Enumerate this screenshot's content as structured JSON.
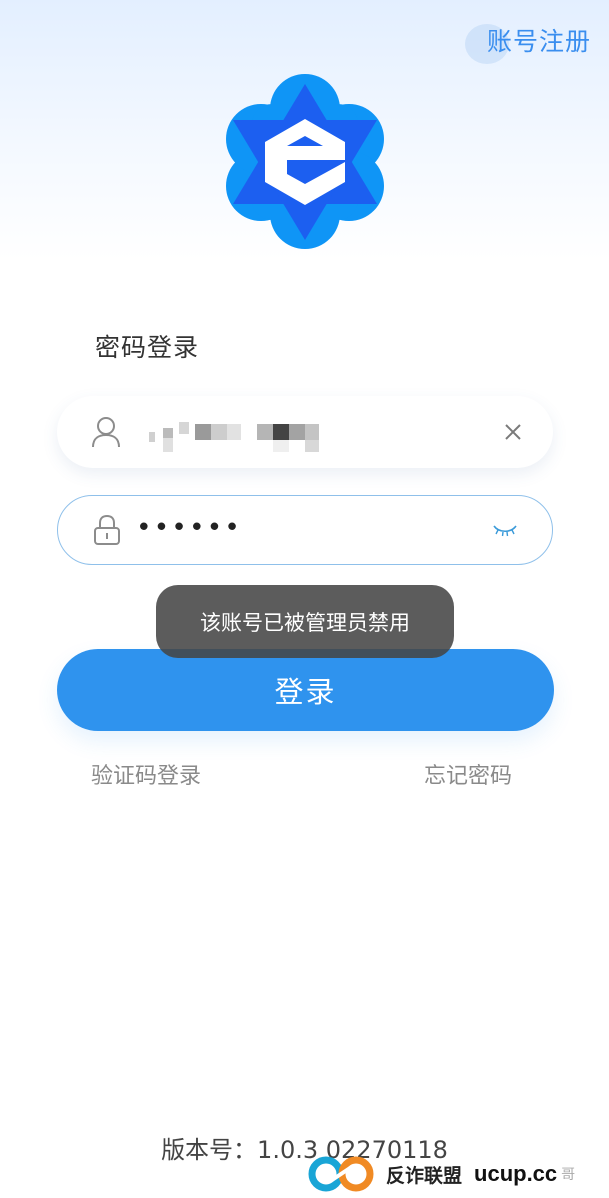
{
  "header": {
    "register_label": "账号注册"
  },
  "login": {
    "title": "密码登录",
    "username_value": "",
    "password_value": "••••••",
    "toast": "该账号已被管理员禁用",
    "submit_label": "登录",
    "sms_login_label": "验证码登录",
    "forgot_label": "忘记密码"
  },
  "footer": {
    "version": "版本号：1.0.3 02270118"
  },
  "watermark": {
    "text": "反诈联盟",
    "domain": "ucup.cc",
    "extra": "哥"
  },
  "colors": {
    "accent": "#2f93ee",
    "logo_blue": "#1f66f2",
    "logo_light": "#0f95f6",
    "field_border": "#8fc0ea"
  },
  "icons": {
    "user": "user-icon",
    "lock": "lock-icon",
    "clear": "clear-icon",
    "eye": "eye-closed-icon",
    "logo": "app-logo"
  }
}
